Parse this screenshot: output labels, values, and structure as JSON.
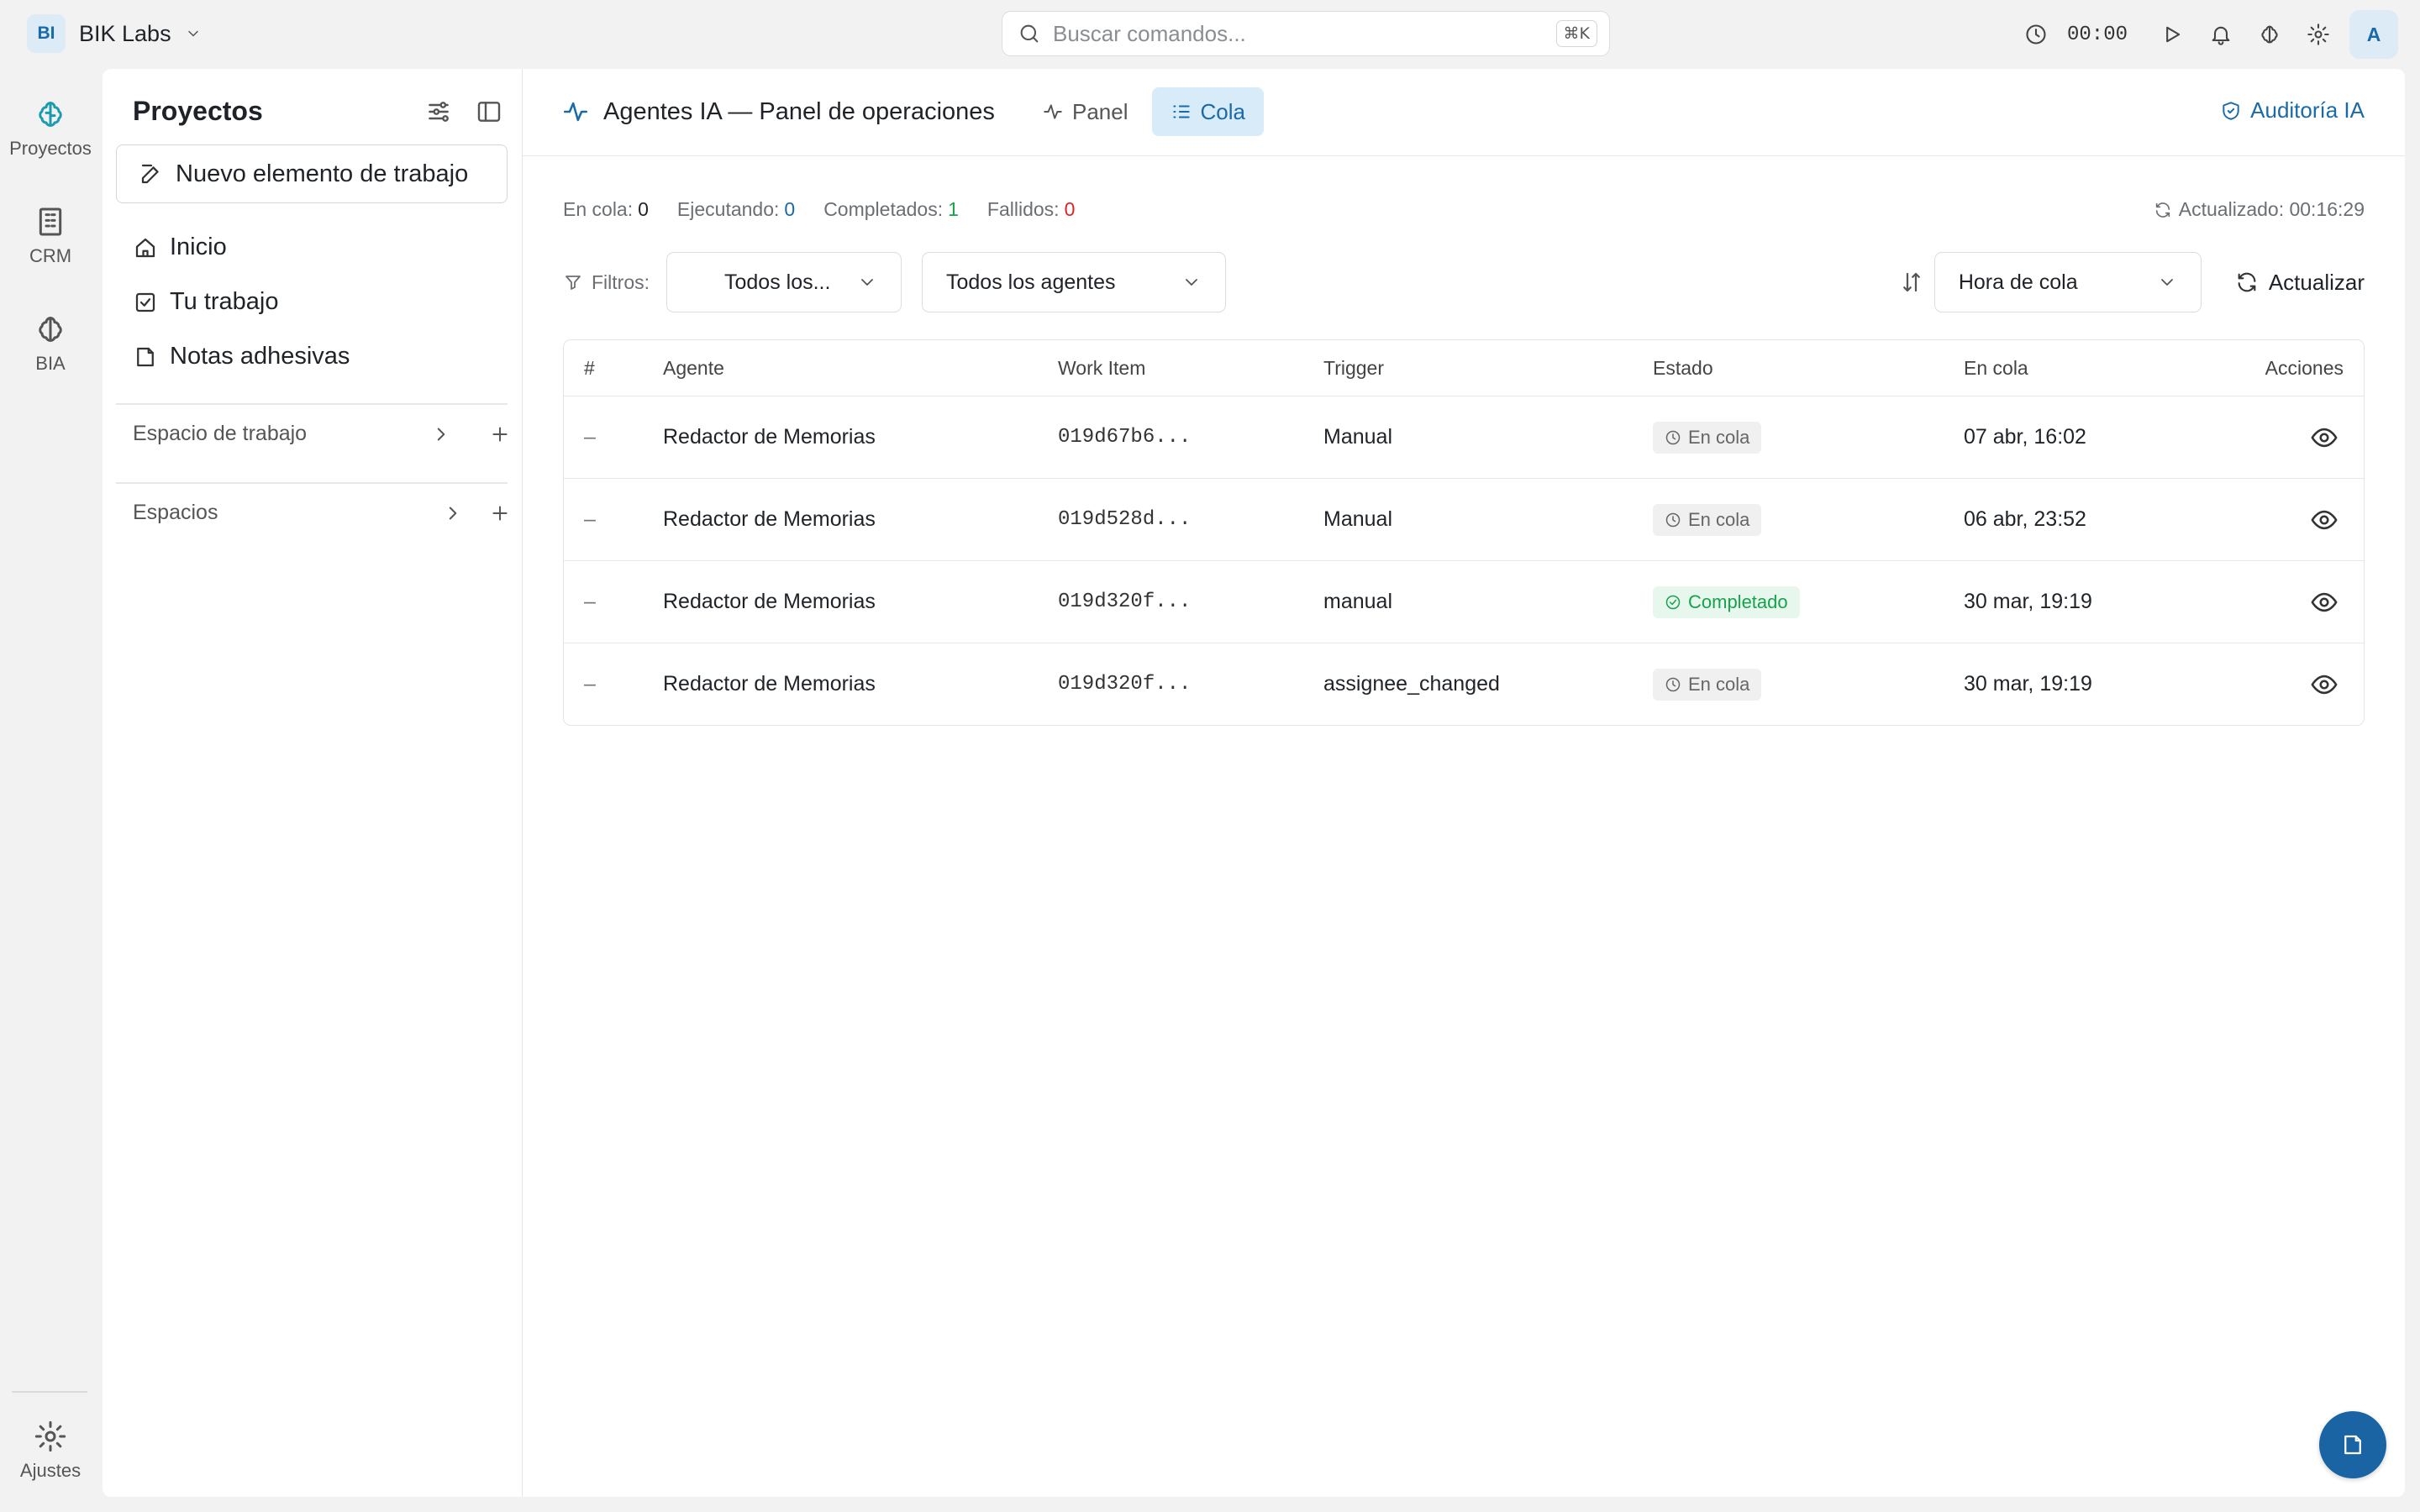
{
  "workspace": {
    "badge": "BI",
    "name": "BIK Labs"
  },
  "search": {
    "placeholder": "Buscar comandos...",
    "shortcut": "⌘K"
  },
  "topbar": {
    "timer": "00:00",
    "avatar": "A"
  },
  "rail": {
    "items": [
      {
        "label": "Proyectos",
        "icon": "brain-circuit-icon"
      },
      {
        "label": "CRM",
        "icon": "building-icon"
      },
      {
        "label": "BIA",
        "icon": "brain-icon"
      }
    ],
    "settings_label": "Ajustes"
  },
  "sidebar": {
    "title": "Proyectos",
    "new_item_label": "Nuevo elemento de trabajo",
    "nav": [
      {
        "label": "Inicio",
        "icon": "home-icon"
      },
      {
        "label": "Tu trabajo",
        "icon": "checkbox-icon"
      },
      {
        "label": "Notas adhesivas",
        "icon": "note-icon"
      }
    ],
    "sections": [
      {
        "label": "Espacio de trabajo"
      },
      {
        "label": "Espacios"
      }
    ]
  },
  "main": {
    "title": "Agentes IA — Panel de operaciones",
    "tabs": [
      {
        "label": "Panel",
        "active": false
      },
      {
        "label": "Cola",
        "active": true
      }
    ],
    "audit_label": "Auditoría IA"
  },
  "stats": {
    "queued_label": "En cola:",
    "queued": "0",
    "running_label": "Ejecutando:",
    "running": "0",
    "completed_label": "Completados:",
    "completed": "1",
    "failed_label": "Fallidos:",
    "failed": "0",
    "updated": "Actualizado: 00:16:29"
  },
  "filters": {
    "label": "Filtros:",
    "status_value": "Todos los...",
    "agent_value": "Todos los agentes",
    "sort_value": "Hora de cola",
    "refresh_label": "Actualizar"
  },
  "table": {
    "headers": [
      "#",
      "Agente",
      "Work Item",
      "Trigger",
      "Estado",
      "En cola",
      "Acciones"
    ],
    "rows": [
      {
        "num": "–",
        "agent": "Redactor de Memorias",
        "work_item": "019d67b6...",
        "trigger": "Manual",
        "status": "En cola",
        "status_kind": "queued",
        "queued_at": "07 abr, 16:02"
      },
      {
        "num": "–",
        "agent": "Redactor de Memorias",
        "work_item": "019d528d...",
        "trigger": "Manual",
        "status": "En cola",
        "status_kind": "queued",
        "queued_at": "06 abr, 23:52"
      },
      {
        "num": "–",
        "agent": "Redactor de Memorias",
        "work_item": "019d320f...",
        "trigger": "manual",
        "status": "Completado",
        "status_kind": "done",
        "queued_at": "30 mar, 19:19"
      },
      {
        "num": "–",
        "agent": "Redactor de Memorias",
        "work_item": "019d320f...",
        "trigger": "assignee_changed",
        "status": "En cola",
        "status_kind": "queued",
        "queued_at": "30 mar, 19:19"
      }
    ]
  },
  "colors": {
    "accent": "#1a6aa8",
    "success": "#16a34a",
    "danger": "#dc2626",
    "tab_active_bg": "#d7ecf8"
  }
}
